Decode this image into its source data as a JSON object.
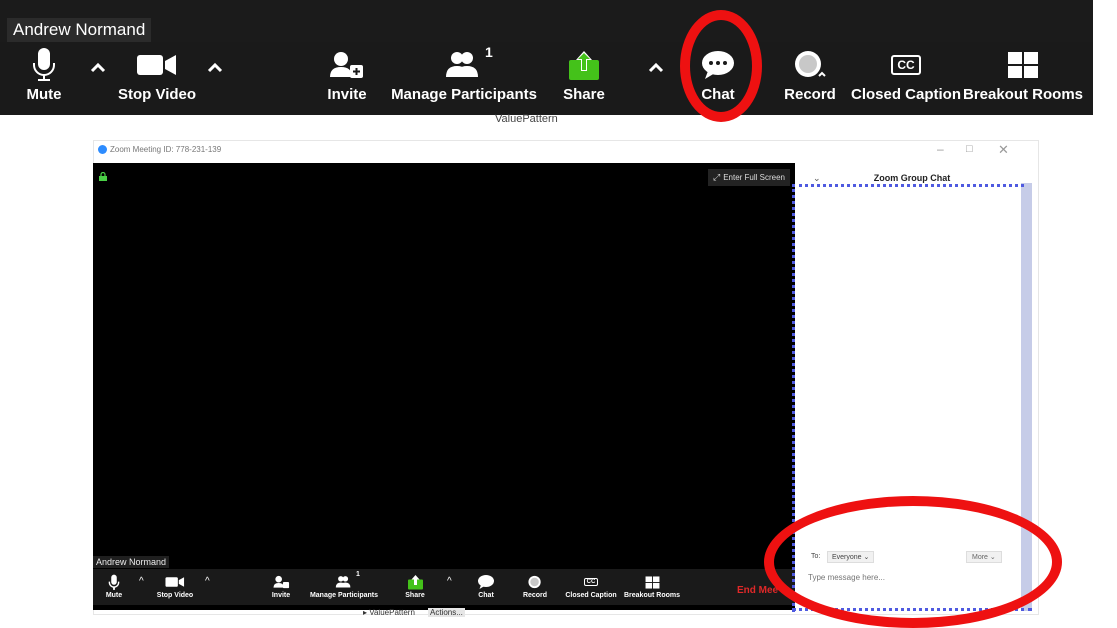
{
  "top_zoom": {
    "participant_name": "Andrew Normand",
    "toolbar": {
      "mute": "Mute",
      "stop_video": "Stop Video",
      "invite": "Invite",
      "manage_participants": "Manage Participants",
      "participants_count": "1",
      "share": "Share",
      "chat": "Chat",
      "record": "Record",
      "cc_badge": "CC",
      "closed_caption": "Closed Caption",
      "breakout_rooms": "Breakout Rooms"
    }
  },
  "background_text": "ValuePattern",
  "window": {
    "title": "Zoom Meeting ID: 778-231-139",
    "minimize": "–",
    "maximize": "□",
    "close": "✕",
    "fullscreen_label": "Enter Full Screen",
    "participant_name": "Andrew Normand",
    "toolbar": {
      "mute": "Mute",
      "stop_video": "Stop Video",
      "invite": "Invite",
      "manage_participants": "Manage Participants",
      "participants_count": "1",
      "share": "Share",
      "chat": "Chat",
      "record": "Record",
      "cc_badge": "CC",
      "closed_caption": "Closed Caption",
      "breakout_rooms": "Breakout Rooms",
      "end_meeting": "End Mee"
    },
    "bottom_text": "▸ ValuePattern",
    "bottom_actions": "Actions..."
  },
  "chat_panel": {
    "title": "Zoom Group Chat",
    "to_label": "To:",
    "to_value": "Everyone ⌄",
    "more_label": "More ⌄",
    "message_placeholder": "Type message here..."
  },
  "colors": {
    "annotation_red": "#ee1111",
    "share_green": "#44c21a",
    "end_red": "#e02828",
    "dotted_blue": "#4f5ae0"
  }
}
